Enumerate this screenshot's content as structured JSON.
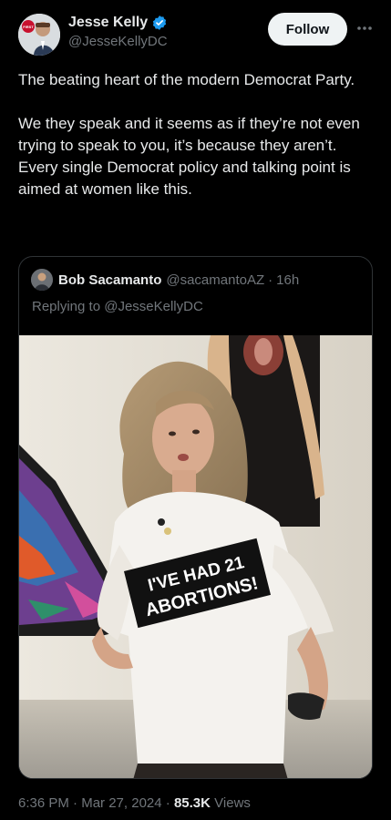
{
  "author": {
    "display_name": "Jesse Kelly",
    "handle": "@JesseKellyDC",
    "verified": true,
    "avatar_icon": "profile-photo",
    "avatar_badge_text": "FIRST"
  },
  "actions": {
    "follow_label": "Follow",
    "more_icon": "more-dots-icon"
  },
  "tweet": {
    "paragraph_1": "The beating heart of the modern Democrat Party.",
    "paragraph_2": "We they speak and it seems as if they’re not even trying to speak to you, it’s because they aren’t. Every single Democrat policy and talking point is aimed at women like this."
  },
  "quote": {
    "display_name": "Bob Sacamanto",
    "handle": "@sacamantoAZ",
    "separator": "·",
    "time_ago": "16h",
    "replying_prefix": "Replying to",
    "replying_to": "@JesseKellyDC",
    "image": {
      "shirt_line_1": "I'VE HAD 21",
      "shirt_line_2": "ABORTIONS!"
    }
  },
  "footer": {
    "time": "6:36 PM",
    "sep1": "·",
    "date": "Mar 27, 2024",
    "sep2": "·",
    "views_count": "85.3K",
    "views_label": "Views"
  },
  "colors": {
    "background": "#000000",
    "text_primary": "#e7e9ea",
    "text_secondary": "#71767b",
    "verified_blue": "#1d9bf0",
    "follow_bg": "#eff3f4",
    "border": "#2f3336"
  }
}
